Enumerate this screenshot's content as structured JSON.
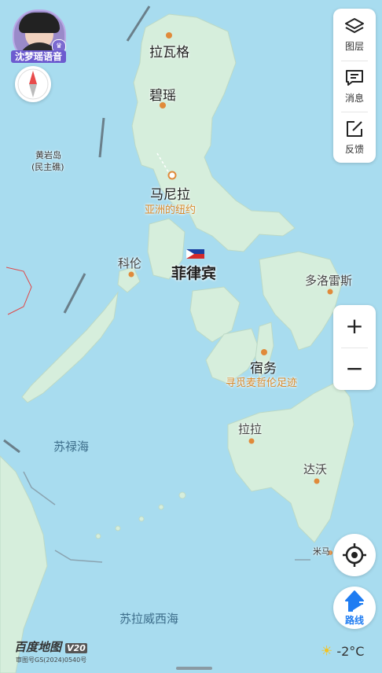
{
  "voice": {
    "label": "沈梦瑶语音"
  },
  "right_panel": {
    "layers_label": "图层",
    "messages_label": "消息",
    "feedback_label": "反馈"
  },
  "zoom": {
    "plus": "+",
    "minus": "−"
  },
  "route": {
    "label": "路线"
  },
  "map_labels": {
    "laoag": "拉瓦格",
    "baguio": "碧瑶",
    "huangyan": "黄岩岛",
    "huangyan_sub": "(民主礁)",
    "manila": "马尼拉",
    "manila_sub": "亚洲的纽约",
    "philippines": "菲律宾",
    "coron": "科伦",
    "tacloban": "多洛雷斯",
    "cebu": "宿务",
    "cebu_sub": "寻觅麦哲伦足迹",
    "dumaguete": "拉拉",
    "davao": "达沃",
    "sulu_sea": "苏禄海",
    "celebes_sea": "苏拉威西海",
    "mibu": "米马"
  },
  "footer": {
    "logo": "百度地图",
    "version": "V20",
    "license": "审图号GS(2024)0540号",
    "temperature": "-2°C"
  },
  "colors": {
    "sea": "#a8dcef",
    "land": "#d6eedc",
    "land_dark": "#bfe1c9",
    "accent_blue": "#1e7cf2",
    "poi_orange": "#e08a3a"
  }
}
